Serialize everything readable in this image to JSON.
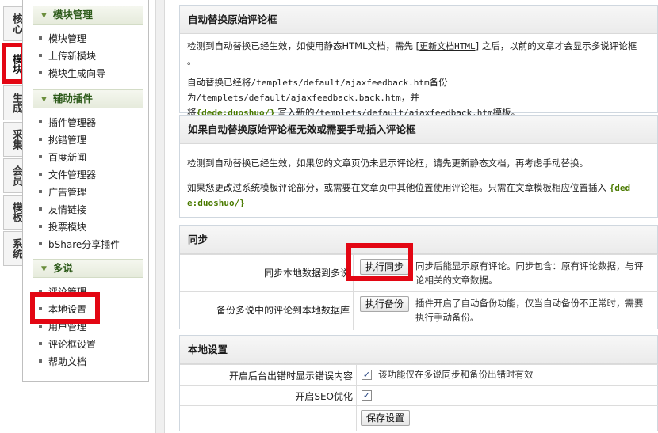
{
  "vtabs": [
    {
      "label": "核心"
    },
    {
      "label": "模块"
    },
    {
      "label": "生成"
    },
    {
      "label": "采集"
    },
    {
      "label": "会员"
    },
    {
      "label": "模板"
    },
    {
      "label": "系统"
    }
  ],
  "sidebar": {
    "sections": [
      {
        "title": "模块管理",
        "items": [
          "模块管理",
          "上传新模块",
          "模块生成向导"
        ]
      },
      {
        "title": "辅助插件",
        "items": [
          "插件管理器",
          "挑错管理",
          "百度新闻",
          "文件管理器",
          "广告管理",
          "友情链接",
          "投票模块",
          "bShare分享插件"
        ]
      },
      {
        "title": "多说",
        "items": [
          "评论管理",
          "本地设置",
          "用户管理",
          "评论框设置",
          "帮助文档"
        ]
      }
    ]
  },
  "panels": {
    "auto_replace": {
      "title": "自动替换原始评论框",
      "p1_a": "检测到自动替换已经生效，如使用静态HTML文档，需先 [",
      "p1_link": "更新文档HTML",
      "p1_b": "] 之后，以前的文章才会显示多说评论框",
      "p1_c": "。",
      "p2_a": "自动替换已经将",
      "p2_path1": "/templets/default/ajaxfeedback.htm",
      "p2_b": "备份为",
      "p2_path2": "/templets/default/ajaxfeedback.back.htm",
      "p2_c": "，并",
      "p2_d": "将",
      "p2_tag": "{dede:duoshuo/}",
      "p2_e": " 写入新的",
      "p2_path3": "/templets/default/ajaxfeedback.htm",
      "p2_f": "模板。"
    },
    "manual": {
      "title": "如果自动替换原始评论框无效或需要手动插入评论框",
      "p1": "检测到自动替换已经生效，如果您的文章页仍未显示评论框，请先更新静态文档，再考虑手动替换。",
      "p2_a": "如果您更改过系统模板评论部分，或需要在文章页中其他位置使用评论框。只需在文章模板相应位置插入",
      "p2_tag1": "{ded",
      "p2_tag2": "e:duoshuo/}"
    },
    "sync": {
      "title": "同步",
      "row1_label": "同步本地数据到多说",
      "row1_button": "执行同步",
      "row1_desc1": "同步后能显示原有评论。同步包含：原有评论数据，与评",
      "row1_desc2": "论相关的文章数据。",
      "row2_label": "备份多说中的评论到本地数据库",
      "row2_button": "执行备份",
      "row2_desc1": "插件开启了自动备份功能，仅当自动备份不正常时，需要",
      "row2_desc2": "执行手动备份。"
    },
    "local": {
      "title": "本地设置",
      "row1_label": "开启后台出错时显示错误内容",
      "row1_desc": "该功能仅在多说同步和备份出错时有效",
      "row1_checked": true,
      "row2_label": "开启SEO优化",
      "row2_checked": true,
      "save_button": "保存设置"
    }
  },
  "highlight_color": "#e30613",
  "accent_green": "#4a7a00"
}
